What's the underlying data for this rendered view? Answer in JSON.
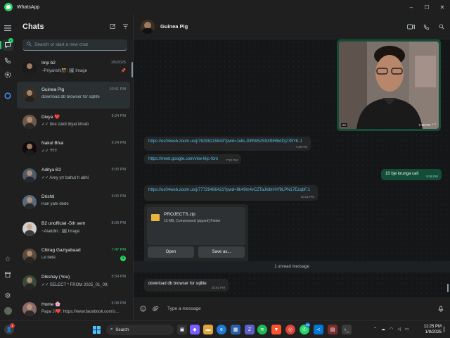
{
  "window": {
    "title": "WhatsApp",
    "minimize": "–",
    "maximize": "☐",
    "close": "✕"
  },
  "chats_panel": {
    "title": "Chats",
    "search_placeholder": "Search or start a new chat",
    "items": [
      {
        "name": "Imp b2",
        "time": "1/5/2025",
        "preview": "~Priyanshi🎊: 🖼 Image",
        "pinned": true,
        "avatar_color": "#1a1a1a"
      },
      {
        "name": "Guinea Pig",
        "time": "10:51 PM",
        "preview": "download db browser for sqllite",
        "selected": true,
        "avatar_color": "#3b2e22"
      },
      {
        "name": "Divya ❤️",
        "time": "9:24 PM",
        "preview": "✓✓ Itne zaldi tbyat khrab",
        "avatar_color": "#6b5a4a"
      },
      {
        "name": "Nakul Bhai",
        "time": "9:24 PM",
        "preview": "✓✓ ???",
        "avatar_color": "#120808"
      },
      {
        "name": "Aditya B2",
        "time": "9:00 PM",
        "preview": "✓✓ Arey yrr bahut h abhi",
        "avatar_color": "#4d5a6a"
      },
      {
        "name": "Drishti",
        "time": "9:00 PM",
        "preview": "Han yahi dede",
        "avatar_color": "#5a6a7a"
      },
      {
        "name": "B2 unofficial -5th sem",
        "time": "8:09 PM",
        "preview": "~Aladdin.: 🖼 Image",
        "avatar_color": "#d0d0d0"
      },
      {
        "name": "Chirag Gaziyabaad",
        "time": "7:47 PM",
        "preview": "Le bete",
        "unread": "1",
        "time_green": true,
        "avatar_color": "#5a4a3a"
      },
      {
        "name": "Dikshay (You)",
        "time": "5:54 PM",
        "preview": "✓✓ SELECT * FROM 2025_01_09;",
        "avatar_color": "#3a4a3a"
      },
      {
        "name": "Home 🌸",
        "time": "5:08 PM",
        "preview": "Papa Ji❤️: https://www.facebook.com/s...",
        "avatar_color": "#8a6a6a"
      }
    ]
  },
  "conversation": {
    "contact_name": "Guinea Pig",
    "photo_time": "7:18 PM",
    "messages": [
      {
        "text": "https://us04web.zoom.us/j/76298215843?pwd=JubLJ0RW52S9XfbRBdDj27BYK.1",
        "time": "7:29 PM",
        "is_link": true
      },
      {
        "text": "https://meet.google.com/vkw-ktjc-fom",
        "time": "7:32 PM",
        "is_link": true
      },
      {
        "text": "10 bje krunga call",
        "time": "9:08 PM",
        "outgoing": true
      },
      {
        "text": "https://us04web.zoom.us/j/77729486421?pwd=9k49m4vCZTaJklbIHYf9LPN17EzqbF.1",
        "time": "10:21 PM",
        "is_link": true
      },
      {
        "text": "download db browser for sqllite",
        "time": "10:51 PM"
      }
    ],
    "file": {
      "name": "PROJECTS.zip",
      "meta": "15 MB, Compressed (zipped) Folder",
      "open_label": "Open",
      "save_label": "Save as...",
      "time": "10:50 PM"
    },
    "unread_divider": "1 unread message",
    "composer_placeholder": "Type a message"
  },
  "taskbar": {
    "search_label": "Search",
    "time": "11:25 PM",
    "date": "1/9/2025",
    "whatsapp_badge": "10",
    "notification_badge": "1"
  },
  "colors": {
    "accent": "#25d366",
    "outgoing_bubble": "#144d37",
    "incoming_bubble": "#242626",
    "link": "#53bdeb"
  }
}
